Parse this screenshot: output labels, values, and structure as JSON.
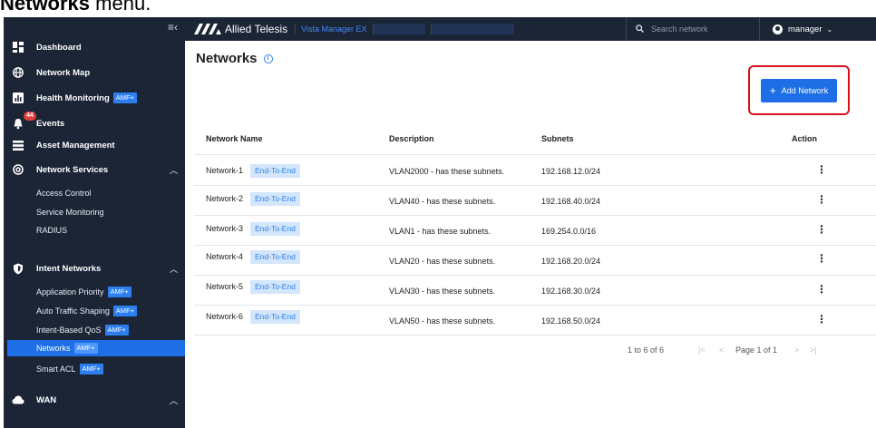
{
  "caption": {
    "bold": "Networks",
    "rest": " menu."
  },
  "sidebar": {
    "collapse_icon": "≡‹",
    "items": [
      {
        "label": "Dashboard",
        "icon": "dashboard-icon",
        "badge_amf": ""
      },
      {
        "label": "Network Map",
        "icon": "globe-icon",
        "badge_amf": ""
      },
      {
        "label": "Health Monitoring",
        "icon": "chart-icon",
        "badge_amf": "AMF+"
      },
      {
        "label": "Events",
        "icon": "bell-icon",
        "badge_amf": "",
        "count": "44"
      },
      {
        "label": "Asset Management",
        "icon": "list-icon",
        "badge_amf": ""
      },
      {
        "label": "Network Services",
        "icon": "at-icon",
        "badge_amf": ""
      }
    ],
    "network_services_sub": [
      "Access Control",
      "Service Monitoring",
      "RADIUS"
    ],
    "intent": {
      "label": "Intent Networks"
    },
    "intent_sub": [
      {
        "label": "Application Priority",
        "amf": "AMF+"
      },
      {
        "label": "Auto Traffic Shaping",
        "amf": "AMF+"
      },
      {
        "label": "Intent-Based QoS",
        "amf": "AMF+"
      },
      {
        "label": "Networks",
        "amf": "AMF+",
        "active": true
      },
      {
        "label": "Smart ACL",
        "amf": "AMF+"
      }
    ],
    "wan": {
      "label": "WAN"
    }
  },
  "topbar": {
    "brand": "Allied Telesis",
    "product": "Vista Manager EX",
    "search_placeholder": "Search network",
    "user": "manager"
  },
  "main": {
    "title": "Networks",
    "add_button": "Add Network",
    "columns": [
      "Network Name",
      "Description",
      "Subnets",
      "Action"
    ],
    "rows": [
      {
        "name": "Network-1",
        "tag": "End-To-End",
        "description": "VLAN2000 - has these subnets.",
        "subnets": "192.168.12.0/24"
      },
      {
        "name": "Network-2",
        "tag": "End-To-End",
        "description": "VLAN40 - has these subnets.",
        "subnets": "192.168.40.0/24"
      },
      {
        "name": "Network-3",
        "tag": "End-To-End",
        "description": "VLAN1 - has these subnets.",
        "subnets": "169.254.0.0/16"
      },
      {
        "name": "Network-4",
        "tag": "End-To-End",
        "description": "VLAN20 - has these subnets.",
        "subnets": "192.168.20.0/24"
      },
      {
        "name": "Network-5",
        "tag": "End-To-End",
        "description": "VLAN30 - has these subnets.",
        "subnets": "192.168.30.0/24"
      },
      {
        "name": "Network-6",
        "tag": "End-To-End",
        "description": "VLAN50 - has these subnets.",
        "subnets": "192.168.50.0/24"
      }
    ],
    "pager": {
      "range": "1 to 6 of 6",
      "page": "Page 1 of 1"
    }
  },
  "colors": {
    "sidebar_bg": "#1b2536",
    "accent": "#1e6fe6",
    "highlight_box": "#d6121c",
    "tag_bg": "#d4e6fb"
  }
}
